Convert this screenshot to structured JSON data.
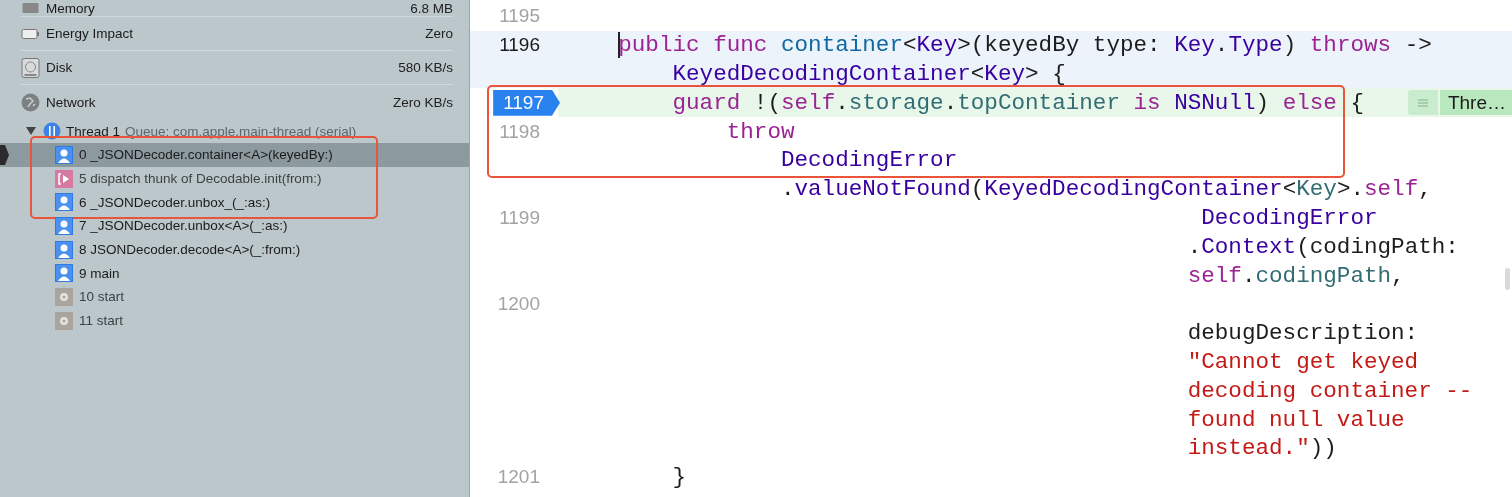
{
  "debug_navigator": {
    "gauges": [
      {
        "label": "Memory",
        "value": "6.8 MB",
        "kind": "memory"
      },
      {
        "label": "Energy Impact",
        "value": "Zero",
        "kind": "energy"
      },
      {
        "label": "Disk",
        "value": "580 KB/s",
        "kind": "disk"
      },
      {
        "label": "Network",
        "value": "Zero KB/s",
        "kind": "network"
      }
    ],
    "thread": {
      "label": "Thread 1",
      "queue": "Queue: com.apple.main-thread (serial)",
      "expanded": true
    },
    "frames": [
      {
        "label": "0 _JSONDecoder.container<A>(keyedBy:)",
        "kind": "user",
        "selected": true,
        "outlined": true
      },
      {
        "label": "5 dispatch thunk of Decodable.init(from:)",
        "kind": "thunk",
        "selected": false,
        "outlined": true
      },
      {
        "label": "6 _JSONDecoder.unbox_(_:as:)",
        "kind": "user",
        "selected": false,
        "outlined": true
      },
      {
        "label": "7 _JSONDecoder.unbox<A>(_:as:)",
        "kind": "user",
        "selected": false,
        "outlined": false
      },
      {
        "label": "8 JSONDecoder.decode<A>(_:from:)",
        "kind": "user",
        "selected": false,
        "outlined": false
      },
      {
        "label": "9 main",
        "kind": "user",
        "selected": false,
        "outlined": false
      },
      {
        "label": "10 start",
        "kind": "system",
        "selected": false,
        "outlined": false
      },
      {
        "label": "11 start",
        "kind": "system",
        "selected": false,
        "outlined": false
      }
    ]
  },
  "editor": {
    "lines": [
      {
        "number": "1195",
        "current": false,
        "paused": false,
        "outlined": false
      },
      {
        "number": "1196",
        "current": true,
        "paused": false,
        "caret": true,
        "outlined": false,
        "tokens": [
          {
            "text": "    public ",
            "kind": "keyword"
          },
          {
            "text": "func ",
            "kind": "keyword"
          },
          {
            "text": "container",
            "kind": "function"
          },
          {
            "text": "<",
            "kind": "plain"
          },
          {
            "text": "Key",
            "kind": "type"
          },
          {
            "text": ">(keyedBy type: ",
            "kind": "plain"
          },
          {
            "text": "Key",
            "kind": "type"
          },
          {
            "text": ".",
            "kind": "plain"
          },
          {
            "text": "Type",
            "kind": "type"
          },
          {
            "text": ") ",
            "kind": "plain"
          },
          {
            "text": "throws",
            "kind": "keyword"
          },
          {
            "text": " ->",
            "kind": "plain"
          }
        ]
      },
      {
        "current": true,
        "paused": false,
        "outlined": false,
        "tokens": [
          {
            "text": "        KeyedDecodingContainer",
            "kind": "type"
          },
          {
            "text": "<",
            "kind": "plain"
          },
          {
            "text": "Key",
            "kind": "type"
          },
          {
            "text": "> {",
            "kind": "plain"
          }
        ]
      },
      {
        "number": "1197",
        "current": false,
        "paused": true,
        "outlined": true,
        "badge": "Thre…",
        "tokens": [
          {
            "text": "        guard",
            "kind": "keyword"
          },
          {
            "text": " !(",
            "kind": "plain"
          },
          {
            "text": "self",
            "kind": "keyword"
          },
          {
            "text": ".",
            "kind": "plain"
          },
          {
            "text": "storage",
            "kind": "property"
          },
          {
            "text": ".",
            "kind": "plain"
          },
          {
            "text": "topContainer ",
            "kind": "property"
          },
          {
            "text": "is ",
            "kind": "keyword"
          },
          {
            "text": "NSNull",
            "kind": "type"
          },
          {
            "text": ") ",
            "kind": "plain"
          },
          {
            "text": "else",
            "kind": "keyword"
          },
          {
            "text": " {",
            "kind": "plain"
          }
        ]
      },
      {
        "number": "1198",
        "current": false,
        "paused": false,
        "outlined": true,
        "tokens": [
          {
            "text": "            throw",
            "kind": "keyword"
          }
        ]
      },
      {
        "current": false,
        "paused": false,
        "outlined": true,
        "tokens": [
          {
            "text": "                DecodingError",
            "kind": "type"
          }
        ]
      },
      {
        "current": false,
        "paused": false,
        "outlined": false,
        "tokens": [
          {
            "text": "                .",
            "kind": "plain"
          },
          {
            "text": "valueNotFound",
            "kind": "type"
          },
          {
            "text": "(",
            "kind": "plain"
          },
          {
            "text": "KeyedDecodingContainer",
            "kind": "type"
          },
          {
            "text": "<",
            "kind": "plain"
          },
          {
            "text": "Key",
            "kind": "property"
          },
          {
            "text": ">.",
            "kind": "plain"
          },
          {
            "text": "self",
            "kind": "keyword"
          },
          {
            "text": ",",
            "kind": "plain"
          }
        ]
      },
      {
        "number": "1199",
        "current": false,
        "paused": false,
        "outlined": false,
        "tokens": [
          {
            "text": "                                               DecodingError",
            "kind": "type"
          }
        ]
      },
      {
        "current": false,
        "paused": false,
        "outlined": false,
        "tokens": [
          {
            "text": "                                              .",
            "kind": "plain"
          },
          {
            "text": "Context",
            "kind": "type"
          },
          {
            "text": "(codingPath:",
            "kind": "plain"
          }
        ]
      },
      {
        "current": false,
        "paused": false,
        "outlined": false,
        "tokens": [
          {
            "text": "                                              self",
            "kind": "keyword"
          },
          {
            "text": ".",
            "kind": "plain"
          },
          {
            "text": "codingPath",
            "kind": "property"
          },
          {
            "text": ",",
            "kind": "plain"
          }
        ]
      },
      {
        "number": "1200",
        "current": false,
        "paused": false,
        "outlined": false
      },
      {
        "current": false,
        "paused": false,
        "outlined": false,
        "tokens": [
          {
            "text": "                                              debugDescription:",
            "kind": "plain"
          }
        ]
      },
      {
        "current": false,
        "paused": false,
        "outlined": false,
        "tokens": [
          {
            "text": "                                              \"Cannot get keyed",
            "kind": "string"
          }
        ]
      },
      {
        "current": false,
        "paused": false,
        "outlined": false,
        "tokens": [
          {
            "text": "                                              decoding container --",
            "kind": "string"
          }
        ]
      },
      {
        "current": false,
        "paused": false,
        "outlined": false,
        "tokens": [
          {
            "text": "                                              found null value",
            "kind": "string"
          }
        ]
      },
      {
        "current": false,
        "paused": false,
        "outlined": false,
        "tokens": [
          {
            "text": "                                              instead.\"",
            "kind": "string"
          },
          {
            "text": "))",
            "kind": "plain"
          }
        ]
      },
      {
        "number": "1201",
        "current": false,
        "paused": false,
        "outlined": false,
        "tokens": [
          {
            "text": "        }",
            "kind": "plain"
          }
        ]
      }
    ]
  }
}
